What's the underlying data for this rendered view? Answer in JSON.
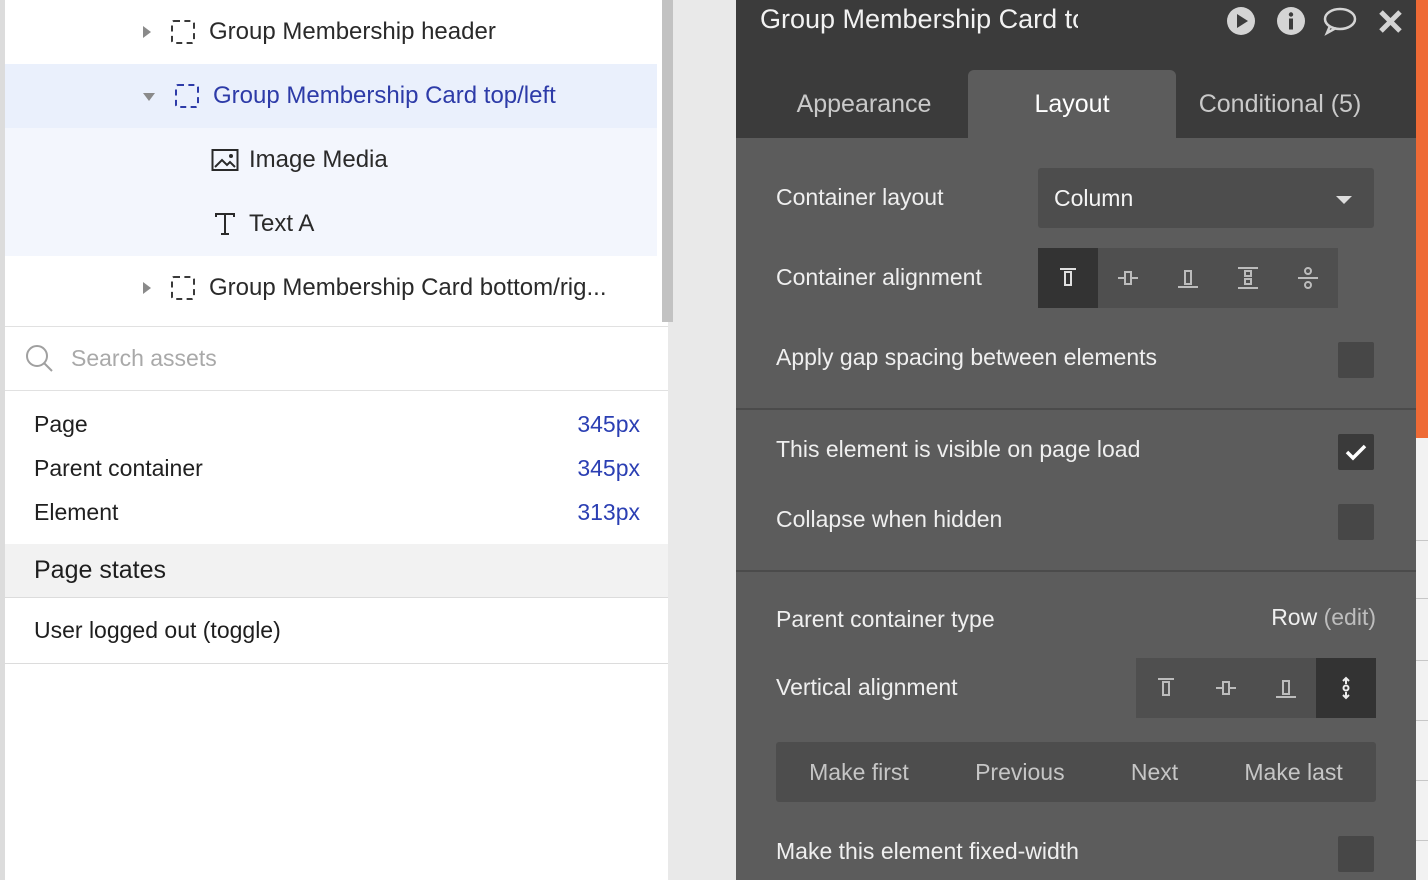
{
  "tree": {
    "items": [
      {
        "label": "Group Membership header",
        "icon": "group-icon",
        "caret": "right"
      },
      {
        "label": "Group Membership Card top/left",
        "icon": "group-icon",
        "caret": "down"
      },
      {
        "label": "Image Media",
        "icon": "image-icon"
      },
      {
        "label": "Text A",
        "icon": "text-icon"
      },
      {
        "label": "Group Membership Card bottom/rig...",
        "icon": "group-icon",
        "caret": "right"
      }
    ]
  },
  "search": {
    "placeholder": "Search assets"
  },
  "dimensions": [
    {
      "label": "Page",
      "value": "345px"
    },
    {
      "label": "Parent container",
      "value": "345px"
    },
    {
      "label": "Element",
      "value": "313px"
    }
  ],
  "page_states": {
    "title": "Page states",
    "items": [
      "User logged out (toggle)"
    ]
  },
  "inspector": {
    "title": "Group Membership Card top/left",
    "tabs": [
      "Appearance",
      "Layout",
      "Conditional (5)"
    ],
    "active_tab": "Layout",
    "container_layout": {
      "label": "Container layout",
      "value": "Column"
    },
    "container_alignment": {
      "label": "Container alignment",
      "selected": "top"
    },
    "gap_spacing": {
      "label": "Apply gap spacing between elements",
      "checked": false
    },
    "visible_on_load": {
      "label": "This element is visible on page load",
      "checked": true
    },
    "collapse_hidden": {
      "label": "Collapse when hidden",
      "checked": false
    },
    "parent_type": {
      "label": "Parent container type",
      "value": "Row",
      "edit": "(edit)"
    },
    "vertical_alignment": {
      "label": "Vertical alignment",
      "selected": "stretch"
    },
    "order_buttons": [
      "Make first",
      "Previous",
      "Next",
      "Make last"
    ],
    "fixed_width": {
      "label": "Make this element fixed-width",
      "checked": false
    }
  },
  "colors": {
    "accent_link": "#2b3fb3",
    "selected_row": "#eaf0fc",
    "inspector_bg": "#5c5c5c",
    "title_bg": "#3b3b3b",
    "canvas_orange": "#ee6a35"
  }
}
